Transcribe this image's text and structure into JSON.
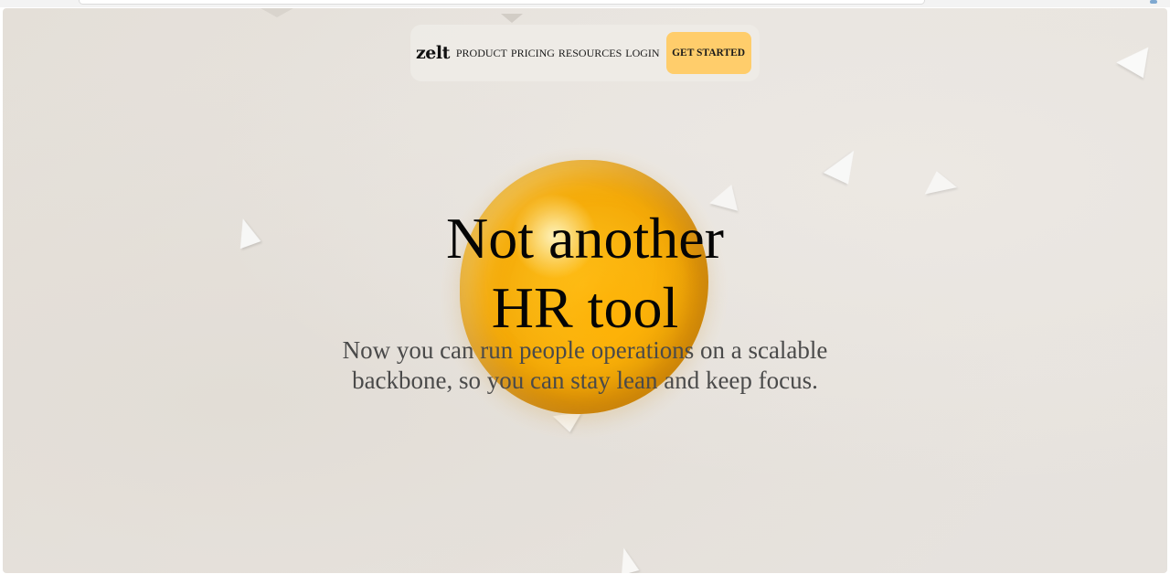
{
  "nav": {
    "logo": "zelt",
    "links": [
      "PRODUCT",
      "PRICING",
      "RESOURCES",
      "LOGIN"
    ],
    "cta_label": "GET STARTED"
  },
  "hero": {
    "headline_line1": "Not another",
    "headline_line2": "HR tool",
    "subtext_line1": "Now you can run people operations on a scalable",
    "subtext_line2": "backbone, so you can stay lean and keep focus."
  },
  "colors": {
    "background": "#e6e1db",
    "accent_button": "#ffcd6b",
    "orb": "#f5a800",
    "headline": "#050505",
    "subtext": "#4a4a4a"
  }
}
